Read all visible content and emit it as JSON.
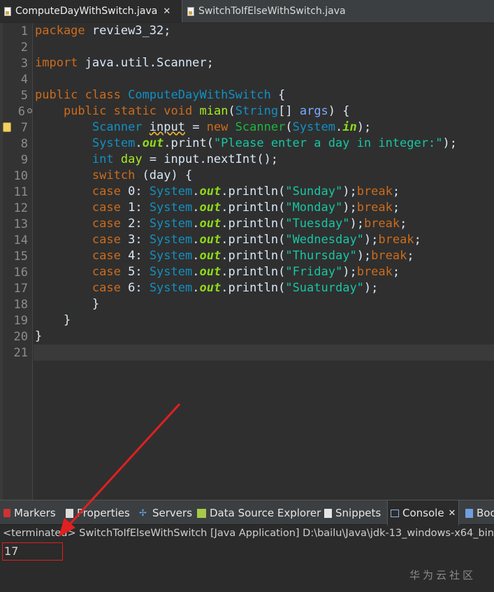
{
  "editor_tabs": [
    {
      "label": "ComputeDayWithSwitch.java",
      "close": "✕",
      "active": true
    },
    {
      "label": "SwitchToIfElseWithSwitch.java",
      "active": false
    }
  ],
  "line_numbers": [
    "1",
    "2",
    "3",
    "4",
    "5",
    "6",
    "7",
    "8",
    "9",
    "10",
    "11",
    "12",
    "13",
    "14",
    "15",
    "16",
    "17",
    "18",
    "19",
    "20",
    "21"
  ],
  "code": {
    "l1_kw": "package",
    "l1_rest": " review3_32;",
    "l3_kw": "import",
    "l3_rest": " java.util.Scanner;",
    "l5_kw1": "public",
    "l5_kw2": "class",
    "l5_cls": "ComputeDayWithSwitch",
    "l5_brace": " {",
    "l6_indent": "    ",
    "l6_kw1": "public",
    "l6_kw2": "static",
    "l6_kw3": "void",
    "l6_fn": "mian",
    "l6_p1": "(",
    "l6_ty": "String",
    "l6_p2": "[] ",
    "l6_par": "args",
    "l6_end": ") {",
    "l7_indent": "        ",
    "l7_ty": "Scanner",
    "l7_var": "input",
    "l7_eq": " = ",
    "l7_kw": "new",
    "l7_ty2": "Scanner",
    "l7_p1": "(",
    "l7_ty3": "System",
    "l7_dot": ".",
    "l7_fld": "in",
    "l7_end": ");",
    "l8_indent": "        ",
    "l8_ty": "System",
    "l8_dot": ".",
    "l8_fld": "out",
    "l8_m": ".print(",
    "l8_str": "\"Please enter a day in integer:\"",
    "l8_end": ");",
    "l9_indent": "        ",
    "l9_kw": "int",
    "l9_var": "day",
    "l9_rest": " = input.nextInt();",
    "l10_indent": "        ",
    "l10_kw": "switch",
    "l10_rest": " (day) {",
    "cases": [
      {
        "kw": "case",
        "num": " 0",
        "colon": ": ",
        "sys": "System",
        "dot": ".",
        "out": "out",
        "m": ".println(",
        "str": "\"Sunday\"",
        "semi": ");",
        "brk": "break",
        "end": ";"
      },
      {
        "kw": "case",
        "num": " 1",
        "colon": ": ",
        "sys": "System",
        "dot": ".",
        "out": "out",
        "m": ".println(",
        "str": "\"Monday\"",
        "semi": ");",
        "brk": "break",
        "end": ";"
      },
      {
        "kw": "case",
        "num": " 2",
        "colon": ": ",
        "sys": "System",
        "dot": ".",
        "out": "out",
        "m": ".println(",
        "str": "\"Tuesday\"",
        "semi": ");",
        "brk": "break",
        "end": ";"
      },
      {
        "kw": "case",
        "num": " 3",
        "colon": ": ",
        "sys": "System",
        "dot": ".",
        "out": "out",
        "m": ".println(",
        "str": "\"Wednesday\"",
        "semi": ");",
        "brk": "break",
        "end": ";"
      },
      {
        "kw": "case",
        "num": " 4",
        "colon": ": ",
        "sys": "System",
        "dot": ".",
        "out": "out",
        "m": ".println(",
        "str": "\"Thursday\"",
        "semi": ");",
        "brk": "break",
        "end": ";"
      },
      {
        "kw": "case",
        "num": " 5",
        "colon": ": ",
        "sys": "System",
        "dot": ".",
        "out": "out",
        "m": ".println(",
        "str": "\"Friday\"",
        "semi": ");",
        "brk": "break",
        "end": ";"
      },
      {
        "kw": "case",
        "num": " 6",
        "colon": ": ",
        "sys": "System",
        "dot": ".",
        "out": "out",
        "m": ".println(",
        "str": "\"Suaturday\"",
        "semi": ");",
        "brk": "",
        "end": ""
      }
    ],
    "l18": "        }",
    "l19": "    }",
    "l20": "}"
  },
  "panel_tabs": [
    {
      "label": "Markers",
      "icon": "markers-icon"
    },
    {
      "label": "Properties",
      "icon": "properties-icon"
    },
    {
      "label": "Servers",
      "icon": "servers-icon"
    },
    {
      "label": "Data Source Explorer",
      "icon": "data-source-icon"
    },
    {
      "label": "Snippets",
      "icon": "snippets-icon"
    },
    {
      "label": "Console",
      "icon": "console-icon",
      "active": true,
      "close": "✕"
    },
    {
      "label": "Boo",
      "icon": "book-icon"
    }
  ],
  "console": {
    "title": "<terminated> SwitchToIfElseWithSwitch [Java Application] D:\\bailu\\Java\\jdk-13_windows-x64_bin",
    "output": "17"
  },
  "watermark": "华为云社区",
  "colors": {
    "annotation_red": "#e02020",
    "keyword": "#cc6c1d",
    "string": "#17c6a3"
  }
}
